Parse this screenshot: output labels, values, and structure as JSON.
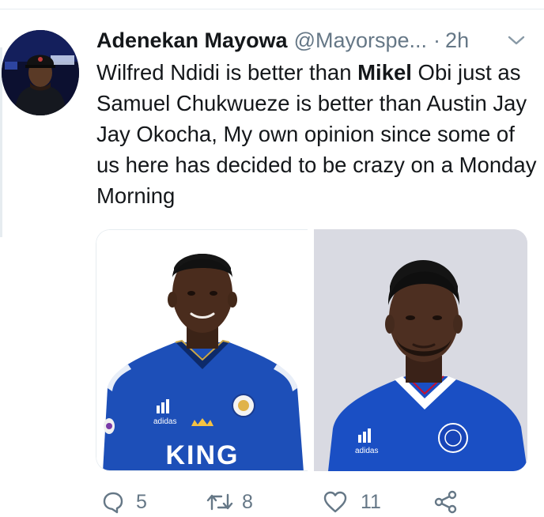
{
  "tweet": {
    "author_name": "Adenekan Mayowa",
    "author_handle": "@Mayorspe...",
    "separator": "·",
    "timestamp": "2h",
    "text_before": "Wilfred Ndidi is better than ",
    "text_bold": "Mikel",
    "text_after": " Obi just as Samuel Chukwueze is better than Austin Jay Jay Okocha, My own opinion since some of us here has decided to be crazy on a Monday Morning",
    "media": {
      "left_jersey_text": "KING",
      "left_brand": "adidas",
      "right_brand": "adidas"
    },
    "actions": {
      "reply_count": "5",
      "retweet_count": "8",
      "like_count": "11"
    }
  },
  "colors": {
    "text": "#14171a",
    "secondary": "#657786",
    "border": "#e6ecf0",
    "leicester_blue": "#1d4fb8",
    "chelsea_blue": "#1a4fc4"
  },
  "icons": {
    "caret": "chevron-down-icon",
    "reply": "comment-icon",
    "retweet": "retweet-icon",
    "like": "heart-icon",
    "share": "share-icon"
  }
}
